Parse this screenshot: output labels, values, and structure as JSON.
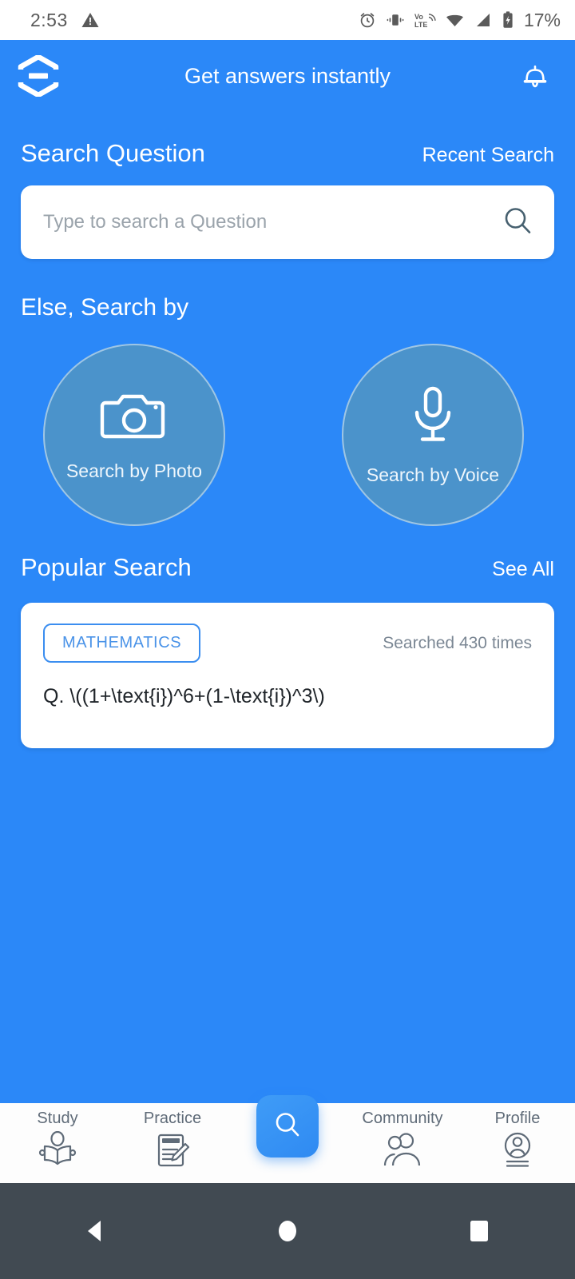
{
  "status_bar": {
    "time": "2:53",
    "battery_percent": "17%",
    "icons": [
      "warning-triangle-icon",
      "alarm-icon",
      "vibrate-icon",
      "volte-icon",
      "wifi-icon",
      "cellular-signal-icon",
      "battery-charging-icon"
    ]
  },
  "app_bar": {
    "title": "Get answers instantly",
    "logo_name": "hexagon-logo",
    "bell_name": "notification-bell-icon"
  },
  "search_section": {
    "title": "Search Question",
    "recent_link": "Recent Search",
    "input_value": "",
    "input_placeholder": "Type to search a Question",
    "search_icon": "search-icon"
  },
  "alt_search": {
    "title": "Else, Search by",
    "options": [
      {
        "label": "Search by Photo",
        "icon": "camera-icon"
      },
      {
        "label": "Search by Voice",
        "icon": "microphone-icon"
      }
    ]
  },
  "popular": {
    "title": "Popular Search",
    "see_all": "See All",
    "cards": [
      {
        "tag": "MATHEMATICS",
        "count": "Searched 430 times",
        "question": "Q. \\((1+\\text{i})^6+(1-\\text{i})^3\\)"
      }
    ]
  },
  "bottom_nav": {
    "items": [
      {
        "label": "Study",
        "icon": "reading-person-icon"
      },
      {
        "label": "Practice",
        "icon": "notepad-pencil-icon"
      },
      {
        "label": "",
        "icon": "search-icon"
      },
      {
        "label": "Community",
        "icon": "people-icon"
      },
      {
        "label": "Profile",
        "icon": "user-circle-icon"
      }
    ]
  },
  "android_nav": {
    "back": "back-triangle-icon",
    "home": "home-circle-icon",
    "recents": "recents-square-icon"
  },
  "colors": {
    "brand_blue": "#2b88f8",
    "circle_fill": "#4b93cb",
    "tag_blue": "#4a93e8",
    "android_nav_bg": "#414a52"
  }
}
